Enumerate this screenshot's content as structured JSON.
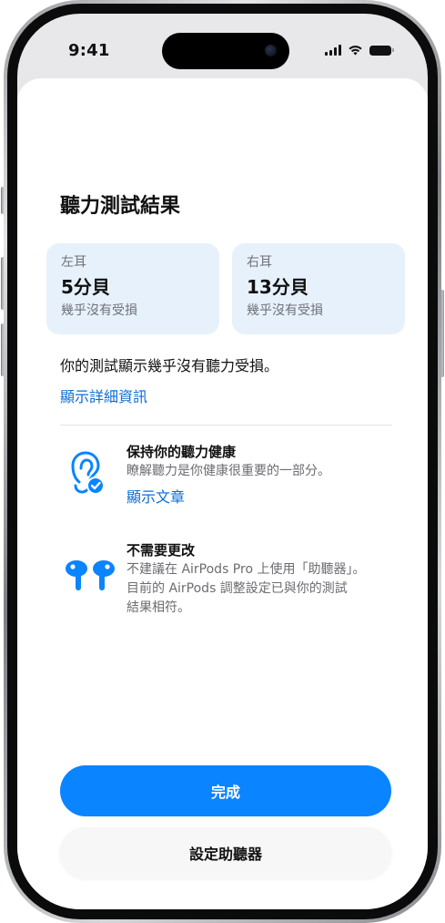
{
  "status_bar": {
    "time": "9:41",
    "icons": [
      "signal-icon",
      "wifi-icon",
      "battery-icon"
    ]
  },
  "sheet": {
    "title": "聽力測試結果",
    "ears": {
      "left": {
        "label": "左耳",
        "value": "5分貝",
        "description": "幾乎沒有受損"
      },
      "right": {
        "label": "右耳",
        "value": "13分貝",
        "description": "幾乎沒有受損"
      }
    },
    "summary": "你的測試顯示幾乎沒有聽力受損。",
    "detail_link": "顯示詳細資訊",
    "health": {
      "title": "保持你的聽力健康",
      "body": "瞭解聽力是你健康很重要的一部分。",
      "link": "顯示文章",
      "icon": "ear-checkmark-icon"
    },
    "no_change": {
      "title": "不需要更改",
      "body_lines": [
        "不建議在 AirPods Pro 上使用「助聽器」。",
        "目前的 AirPods 調整設定已與你的測試",
        "結果相符。"
      ],
      "icon": "airpods-pro-icon"
    },
    "buttons": {
      "done": "完成",
      "setup": "設定助聽器"
    }
  },
  "colors": {
    "accent": "#0A84FF",
    "link": "#0A6DD4",
    "card_background": "#E6F1FB"
  }
}
